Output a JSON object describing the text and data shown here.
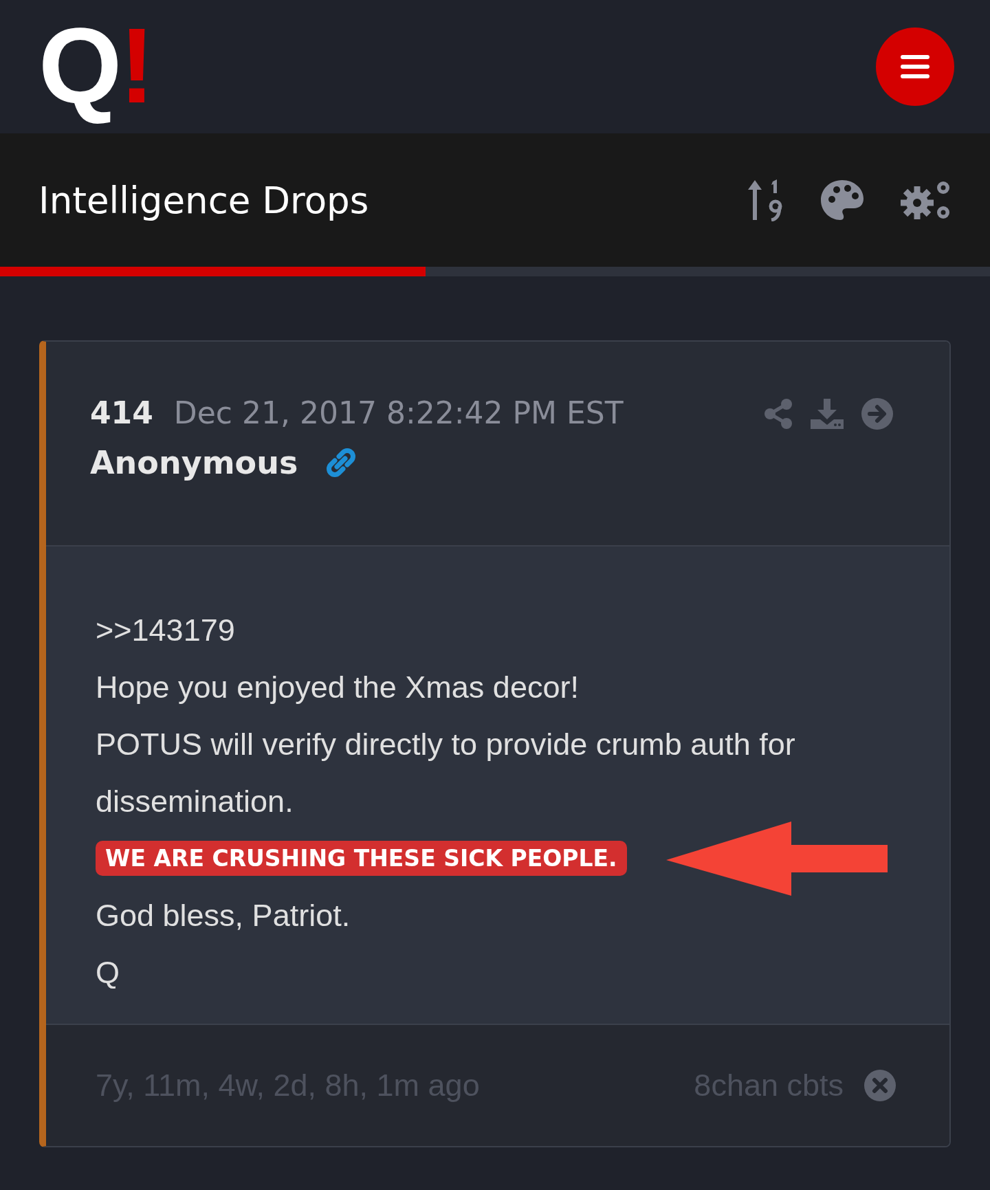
{
  "logo": {
    "letter": "Q",
    "mark": "!"
  },
  "toolbar": {
    "title": "Intelligence Drops",
    "progress": {
      "level": 0.43
    }
  },
  "post": {
    "number": "414",
    "date": "Dec 21, 2017 8:22:42 PM EST",
    "author": "Anonymous",
    "lines": [
      {
        "kind": "text",
        "text": ">>143179"
      },
      {
        "kind": "text",
        "text": "Hope you enjoyed the Xmas decor!"
      },
      {
        "kind": "text",
        "text": "POTUS will verify directly to provide crumb auth for dissemination."
      },
      {
        "kind": "highlight",
        "text": "WE ARE CRUSHING THESE SICK PEOPLE."
      },
      {
        "kind": "text",
        "text": "God bless, Patriot."
      },
      {
        "kind": "text",
        "text": "Q"
      }
    ],
    "age": "7y, 11m, 4w, 2d, 8h, 1m ago",
    "source": "8chan cbts"
  }
}
